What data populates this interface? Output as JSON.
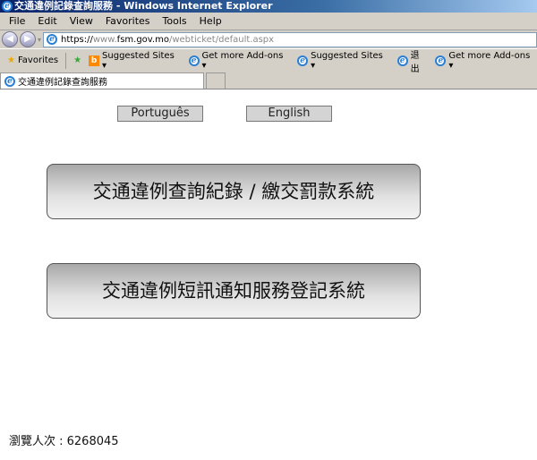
{
  "window": {
    "title": "交通違例記錄查詢服務 - Windows Internet Explorer"
  },
  "menu": [
    "File",
    "Edit",
    "View",
    "Favorites",
    "Tools",
    "Help"
  ],
  "address": {
    "scheme": "https://",
    "host": "www.fsm.gov.mo",
    "path": "/webticket/default.aspx"
  },
  "favorites": {
    "label": "Favorites",
    "items": [
      "Suggested Sites ▾",
      "Get more Add-ons ▾",
      "Suggested Sites ▾",
      "退出",
      "Get more Add-ons ▾"
    ]
  },
  "tab": {
    "title": "交通違例記錄查詢服務"
  },
  "page": {
    "lang_pt": "Português",
    "lang_en": "English",
    "btn_query": "交通違例查詢紀錄 / 繳交罰款系統",
    "btn_sms": "交通違例短訊通知服務登記系統",
    "counter": "瀏覽人次 : 6268045"
  }
}
